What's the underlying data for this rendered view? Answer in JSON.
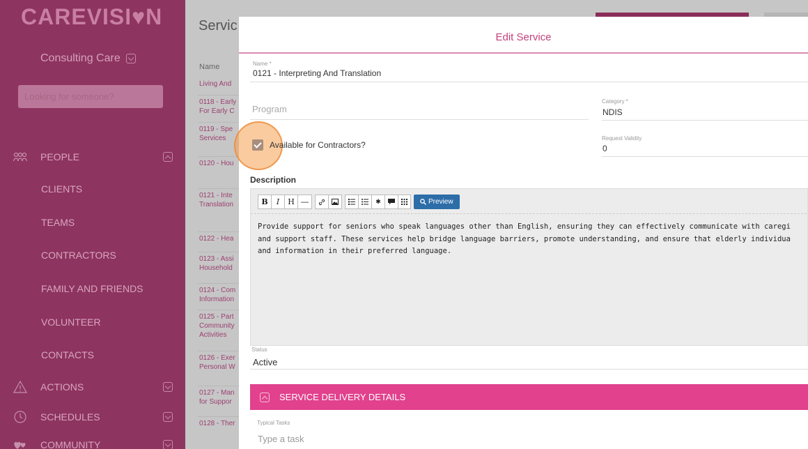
{
  "sidebar": {
    "logo_text": "CAREVISI",
    "logo_heart": "♥",
    "logo_tail": "N",
    "org_name": "Consulting Care",
    "search_placeholder": "Looking for someone?",
    "people_label": "PEOPLE",
    "items": [
      "CLIENTS",
      "TEAMS",
      "CONTRACTORS",
      "FAMILY AND FRIENDS",
      "VOLUNTEER",
      "CONTACTS"
    ],
    "actions_label": "ACTIONS",
    "schedules_label": "SCHEDULES",
    "community_label": "COMMUNITY"
  },
  "background": {
    "page_title": "Servic",
    "column_header": "Name",
    "rows": [
      [
        "Living And"
      ],
      [
        "0118 - Early",
        "For Early C"
      ],
      [
        "0119 - Spe",
        "Services"
      ],
      [
        "0120 - Hou"
      ],
      [
        "0121 - Inte",
        "Translation"
      ],
      [
        "0122 - Hea"
      ],
      [
        "0123 - Assi",
        "Household"
      ],
      [
        "0124 - Com",
        "Information"
      ],
      [
        "0125 - Part",
        "Community",
        "Activities"
      ],
      [
        "0126 - Exer",
        "Personal W"
      ],
      [
        "0127 - Man",
        "for Suppor"
      ],
      [
        "0128 - Ther"
      ]
    ]
  },
  "modal": {
    "title": "Edit Service",
    "name_label": "Name *",
    "name_value": "0121 - Interpreting And Translation",
    "program_placeholder": "Program",
    "category_label": "Category *",
    "category_value": "NDIS",
    "available_label": "Available for Contractors?",
    "available_checked": true,
    "request_validity_label": "Request Validity",
    "request_validity_value": "0",
    "description_label": "Description",
    "toolbar": {
      "bold": "B",
      "italic": "I",
      "heading": "H",
      "hr": "—",
      "link": "🔗",
      "image": "▣",
      "ol": "≔",
      "ul": "☰",
      "asterisk": "✱",
      "comment": "▬",
      "grid": "⊞",
      "preview_label": "Preview"
    },
    "description_lines": [
      "Provide support for seniors who speak languages other than English, ensuring they can effectively communicate with caregi",
      "and support staff. These services help bridge language barriers, promote understanding, and ensure that elderly individua",
      "and information in their preferred language."
    ],
    "status_label": "Status",
    "status_value": "Active",
    "section_title": "SERVICE DELIVERY DETAILS",
    "typical_tasks_label": "Typical Tasks",
    "typical_tasks_placeholder": "Type a task"
  },
  "colors": {
    "sidebar_bg": "#8e3460",
    "accent_pink": "#e1418d",
    "preview_blue": "#2d6da8"
  }
}
